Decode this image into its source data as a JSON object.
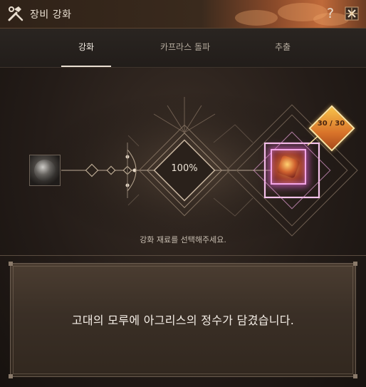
{
  "window": {
    "title": "장비 강화"
  },
  "tabs": [
    {
      "label": "강화",
      "active": true
    },
    {
      "label": "카프라스 돌파",
      "active": false
    },
    {
      "label": "추출",
      "active": false
    }
  ],
  "enhance": {
    "success_rate": "100%",
    "count": "30 / 30",
    "hint": "강화 재료를 선택해주세요."
  },
  "message": "고대의 모루에 아그리스의 정수가 담겼습니다.",
  "icons": {
    "title": "hammer-wrench-icon",
    "help": "question-mark-icon",
    "close": "close-emblem-icon"
  },
  "colors": {
    "accent_pink": "#f3a6e6",
    "accent_gold": "#f8c24a",
    "title_glow": "#c06a3a"
  }
}
